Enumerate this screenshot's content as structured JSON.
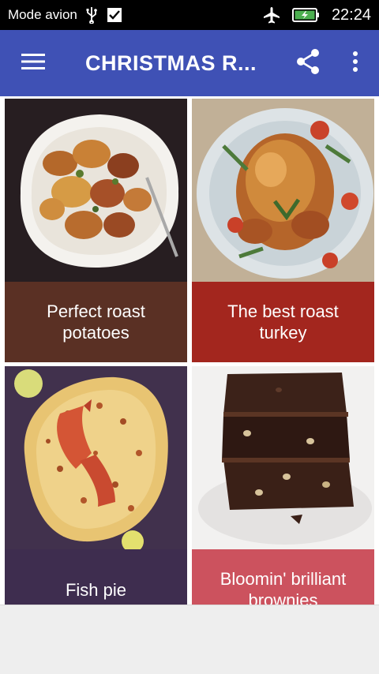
{
  "status_bar": {
    "carrier": "Mode avion",
    "time": "22:24",
    "icons": [
      "usb-icon",
      "notification-check-icon",
      "airplane-icon",
      "battery-charging-icon"
    ]
  },
  "app_bar": {
    "title": "CHRISTMAS R...",
    "icons": [
      "menu-icon",
      "share-icon",
      "more-vert-icon"
    ]
  },
  "recipes": [
    {
      "title": "Perfect roast potatoes",
      "caption_color": "#5a3024",
      "image": "roast-potatoes-photo"
    },
    {
      "title": "The best roast turkey",
      "caption_color": "#a3261e",
      "image": "roast-turkey-photo"
    },
    {
      "title": "Fish pie",
      "caption_color": "#3e2d4f",
      "image": "fish-pie-photo"
    },
    {
      "title": "Bloomin' brilliant brownies",
      "caption_color": "#cc525e",
      "image": "brownies-photo"
    }
  ],
  "colors": {
    "app_bar": "#3f51b5",
    "status_bar": "#000000",
    "background": "#eeeeee"
  }
}
